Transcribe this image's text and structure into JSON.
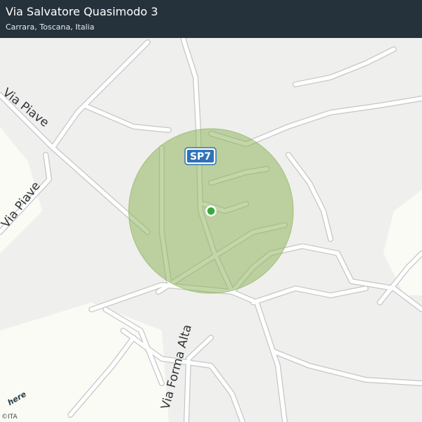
{
  "header": {
    "title": "Via Salvatore Quasimodo 3",
    "subtitle": "Carrara, Toscana, Italia"
  },
  "map": {
    "road_labels": {
      "via_piave_upper": "Via Piave",
      "via_piave_lower": "Via Piave",
      "via_forma_alta": "Via Forma Alta"
    },
    "route_shield": "SP7",
    "colors": {
      "background": "#f9fbf4",
      "road": "#ffffff",
      "road_casing": "#c8cacb",
      "urban_area": "#efefed",
      "accuracy_circle": "#8fb55e",
      "marker": "#3aa83a",
      "shield": "#2f73b6",
      "header": "#26323b"
    }
  },
  "attribution": {
    "logo": "here",
    "copyright": "©ITA"
  }
}
